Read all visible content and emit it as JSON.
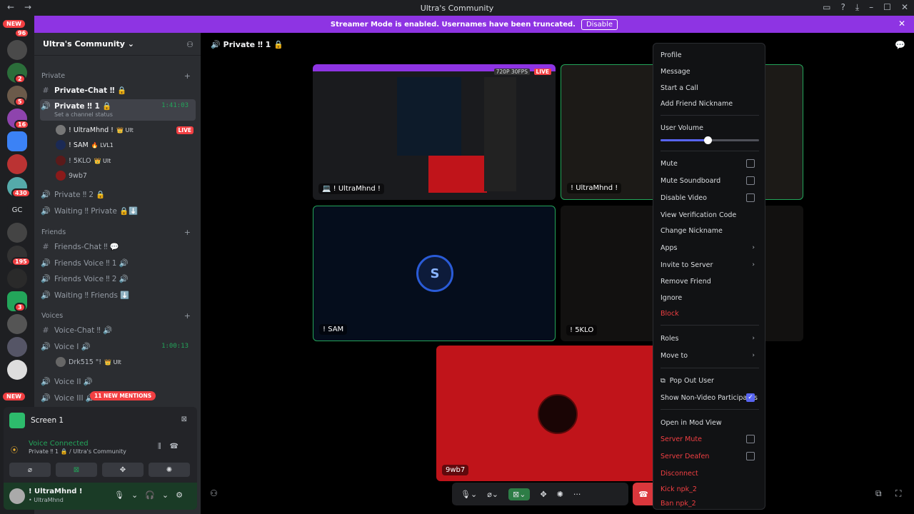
{
  "window": {
    "title": "Ultra's Community"
  },
  "banner": {
    "text": "Streamer Mode is enabled. Usernames have been truncated.",
    "button": "Disable"
  },
  "guild_badges": {
    "new_top": "NEW",
    "b1": "96",
    "b2": "2",
    "b3": "5",
    "b4": "16",
    "b5": "430",
    "gc": "GC",
    "b6": "195",
    "b7": "3",
    "new_bottom": "NEW"
  },
  "server": {
    "name": "Ultra's Community"
  },
  "categories": {
    "private": "Private",
    "friends": "Friends",
    "voices": "Voices"
  },
  "channels": {
    "private_chat": "Private-Chat ‼ 🔒",
    "private1": "Private ‼ 1 🔒",
    "private1_status": "Set a channel status",
    "private1_timer": "1:41:03",
    "private2": "Private ‼ 2 🔒",
    "waiting_private": "Waiting ‼ Private 🔒⬇️",
    "friends_chat": "Friends-Chat ‼ 💬",
    "friends_voice1": "Friends Voice ‼ 1 🔊",
    "friends_voice2": "Friends Voice ‼ 2 🔊",
    "waiting_friends": "Waiting ‼ Friends ⬇️",
    "voice_chat": "Voice-Chat ‼ 🔊",
    "voice1": "Voice I 🔊",
    "voice1_timer": "1:00:13",
    "voice2": "Voice II 🔊",
    "voice3": "Voice III 🔊",
    "mentions": "11 NEW MENTIONS"
  },
  "voice_users": [
    {
      "name": "! UltraMhnd !",
      "tag": "👑 Ult",
      "live": "LIVE"
    },
    {
      "name": "! SAM",
      "tag": "🔥 LVL1"
    },
    {
      "name": "! 5KLO",
      "tag": "👑 Ult"
    },
    {
      "name": "9wb7"
    }
  ],
  "voice1_users": [
    {
      "name": "Drk515 \"!",
      "tag": "👑 Ult"
    }
  ],
  "panel": {
    "screen": "Screen 1",
    "status": "Voice Connected",
    "location": "Private ‼ 1 🔒 / Ultra's Community"
  },
  "me": {
    "name": "! UltraMhnd !",
    "sub": "• UltraMhnd"
  },
  "main": {
    "channel": "Private ‼ 1 🔒"
  },
  "tiles": {
    "t1_label": "💻 ! UltraMhnd !",
    "t1_quality": "720P 30FPS",
    "t1_live": "LIVE",
    "t2_label": "! UltraMhnd !",
    "t3_label": "! SAM",
    "t4_label": "! 5KLO",
    "t5_label": "9wb7"
  },
  "menu": {
    "profile": "Profile",
    "message": "Message",
    "start_call": "Start a Call",
    "add_nick": "Add Friend Nickname",
    "user_volume": "User Volume",
    "user_volume_level": 0.48,
    "mute": "Mute",
    "mute_soundboard": "Mute Soundboard",
    "disable_video": "Disable Video",
    "view_verif": "View Verification Code",
    "change_nick": "Change Nickname",
    "apps": "Apps",
    "invite": "Invite to Server",
    "remove_friend": "Remove Friend",
    "ignore": "Ignore",
    "block": "Block",
    "roles": "Roles",
    "move_to": "Move to",
    "pop_out": "Pop Out User",
    "show_nonvideo": "Show Non-Video Participants",
    "mod_view": "Open in Mod View",
    "server_mute": "Server Mute",
    "server_deafen": "Server Deafen",
    "disconnect": "Disconnect",
    "kick": "Kick npk_2",
    "ban": "Ban npk_2"
  },
  "colors": {
    "accent": "#5865f2",
    "danger": "#f23f42",
    "online": "#23a55a",
    "banner": "#8e34e3"
  }
}
